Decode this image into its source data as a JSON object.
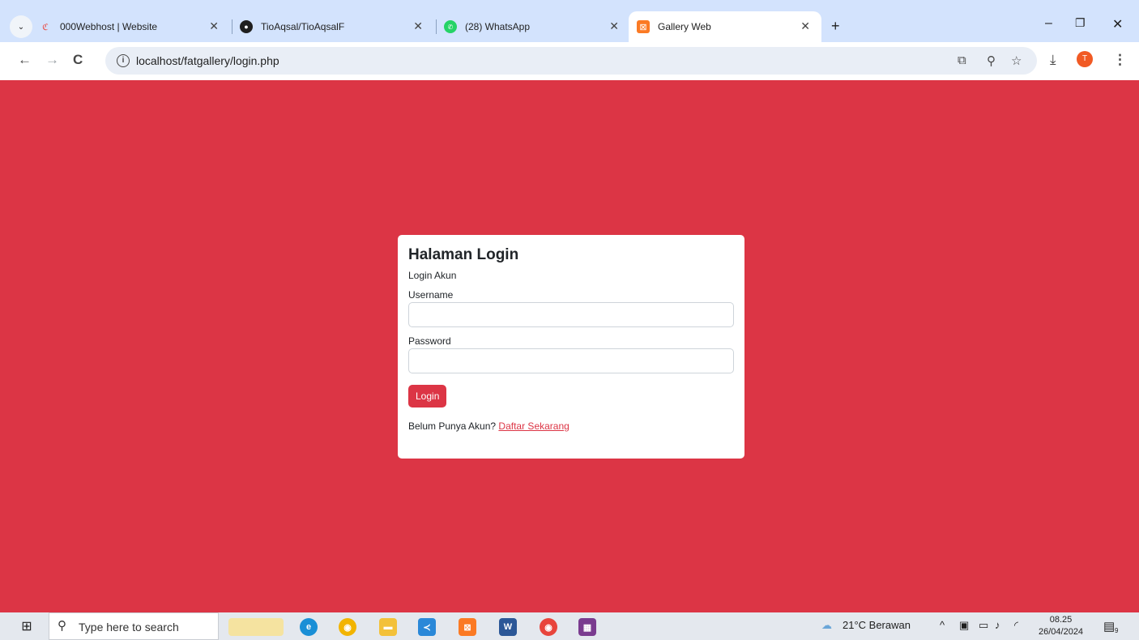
{
  "browser": {
    "tabs": [
      {
        "title": "000Webhost | Website",
        "icon": "webhost-icon"
      },
      {
        "title": "TioAqsal/TioAqsalF",
        "icon": "github-icon"
      },
      {
        "title": "(28) WhatsApp",
        "icon": "whatsapp-icon"
      },
      {
        "title": "Gallery Web",
        "icon": "xampp-icon"
      }
    ],
    "active_tab_index": 3,
    "url": "localhost/fatgallery/login.php",
    "profile_initial": "T"
  },
  "page": {
    "background_color": "#dc3545",
    "title": "Halaman Login",
    "subtitle": "Login Akun",
    "username_label": "Username",
    "username_value": "",
    "password_label": "Password",
    "password_value": "",
    "login_button": "Login",
    "register_text": "Belum Punya Akun?",
    "register_link": "Daftar Sekarang"
  },
  "taskbar": {
    "search_placeholder": "Type here to search",
    "weather": "21°C  Berawan",
    "time": "08.25",
    "date": "26/04/2024",
    "notification_count": "9"
  }
}
